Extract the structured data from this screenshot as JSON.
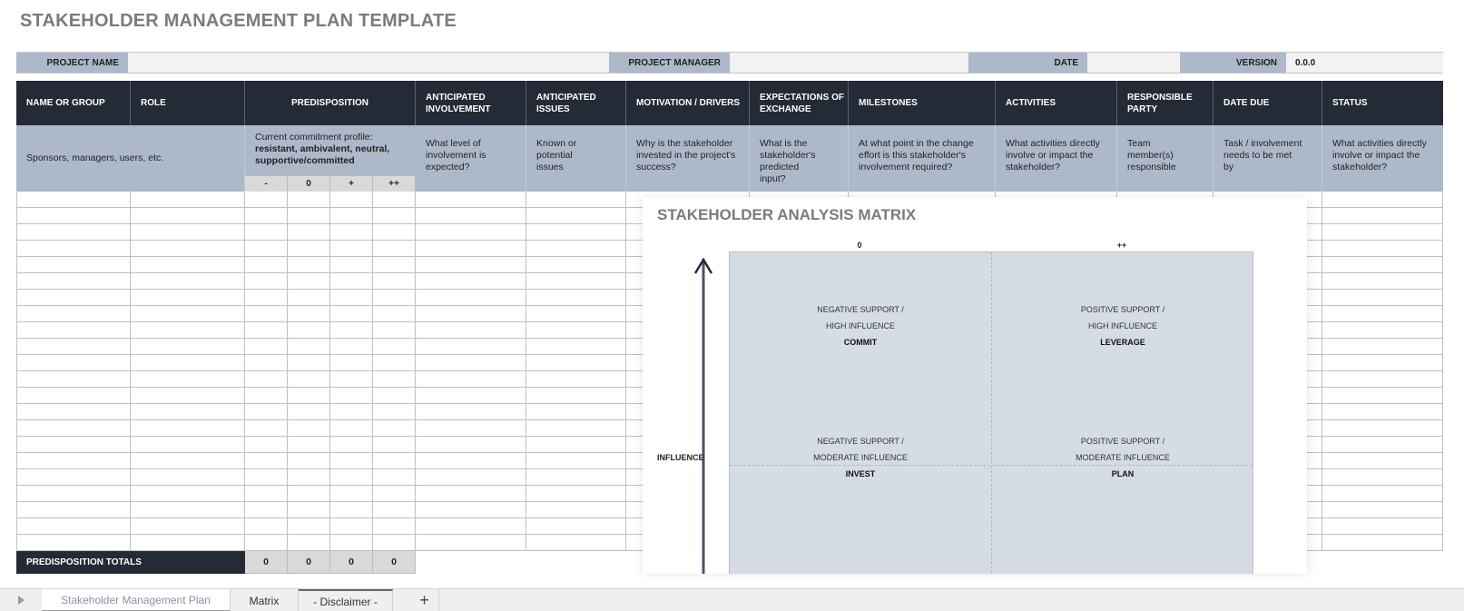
{
  "title": "STAKEHOLDER MANAGEMENT PLAN TEMPLATE",
  "info": {
    "project_name_label": "PROJECT NAME",
    "project_name_value": "",
    "project_manager_label": "PROJECT MANAGER",
    "project_manager_value": "",
    "date_label": "DATE",
    "date_value": "",
    "version_label": "VERSION",
    "version_value": "0.0.0"
  },
  "columns": [
    {
      "header": "NAME OR GROUP",
      "description": "Sponsors, managers, users, etc."
    },
    {
      "header": "ROLE",
      "description": ""
    },
    {
      "header": "PREDISPOSITION",
      "description_intro": "Current commitment profile:",
      "description_bold": "resistant, ambivalent, neutral, supportive/committed"
    },
    {
      "header": "ANTICIPATED INVOLVEMENT",
      "description": "What level of involvement is expected?"
    },
    {
      "header": "ANTICIPATED ISSUES",
      "description": "Known or potential issues"
    },
    {
      "header": "MOTIVATION / DRIVERS",
      "description": "Why is the stakeholder invested in the project's success?"
    },
    {
      "header": "EXPECTATIONS OF EXCHANGE",
      "description": "What is the stakeholder's predicted input?"
    },
    {
      "header": "MILESTONES",
      "description": "At what point in the change effort is this stakeholder's involvement required?"
    },
    {
      "header": "ACTIVITIES",
      "description": "What activities directly involve or impact the stakeholder?"
    },
    {
      "header": "RESPONSIBLE PARTY",
      "description": "Team member(s) responsible"
    },
    {
      "header": "DATE DUE",
      "description": "Task / involvement needs to be met by"
    },
    {
      "header": "STATUS",
      "description": "What activities directly involve or impact the stakeholder?"
    }
  ],
  "predisposition_scale": [
    "-",
    "0",
    "+",
    "++"
  ],
  "totals": {
    "label": "PREDISPOSITION TOTALS",
    "values": [
      "0",
      "0",
      "0",
      "0"
    ]
  },
  "matrix": {
    "title": "STAKEHOLDER ANALYSIS MATRIX",
    "top_axis": [
      "0",
      "++"
    ],
    "side_axis_label": "INFLUENCE",
    "quadrants": [
      {
        "line1": "NEGATIVE SUPPORT /",
        "line2": "HIGH INFLUENCE",
        "action": "COMMIT"
      },
      {
        "line1": "POSITIVE SUPPORT /",
        "line2": "HIGH INFLUENCE",
        "action": "LEVERAGE"
      },
      {
        "line1": "NEGATIVE SUPPORT /",
        "line2": "MODERATE INFLUENCE",
        "action": "INVEST"
      },
      {
        "line1": "POSITIVE SUPPORT /",
        "line2": "MODERATE INFLUENCE",
        "action": "PLAN"
      }
    ]
  },
  "tabs": [
    {
      "label": "Stakeholder Management Plan",
      "active": true
    },
    {
      "label": "Matrix",
      "active": false
    },
    {
      "label": "- Disclaimer -",
      "active": false
    }
  ],
  "add_tab_label": "+",
  "colors": {
    "header_dark": "#242a36",
    "band_bluegray": "#adb9ca",
    "matrix_fill": "#d6dce4",
    "title_gray": "#7b7b7b"
  }
}
